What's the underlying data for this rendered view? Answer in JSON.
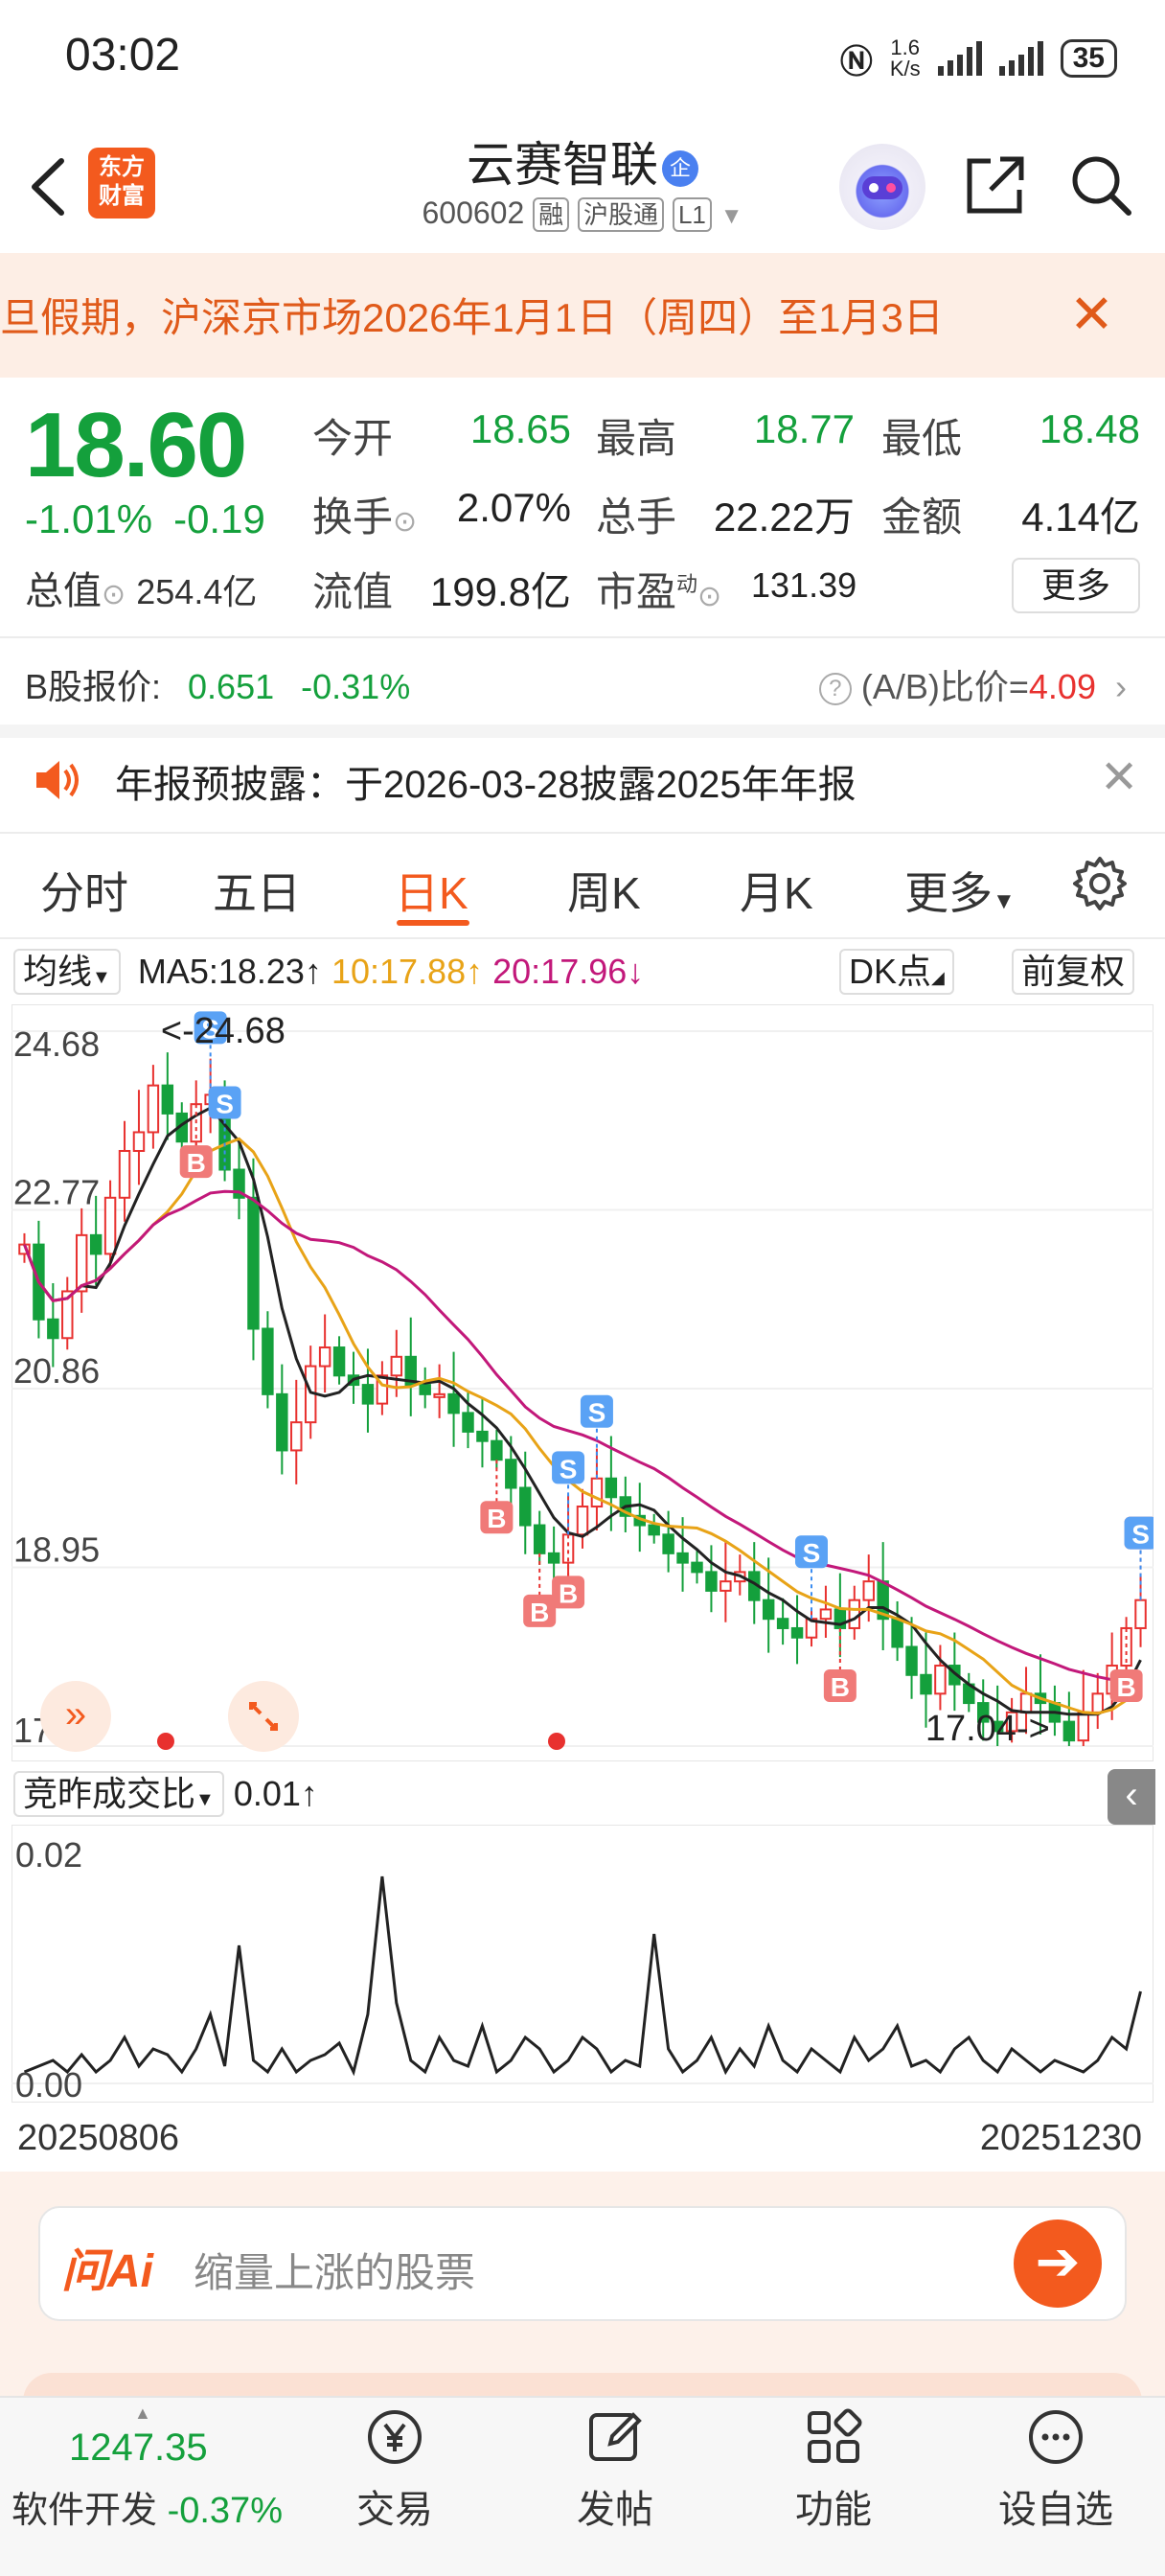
{
  "status_bar": {
    "time": "03:02",
    "net_speed": "1.6",
    "net_unit": "K/s",
    "battery": "35"
  },
  "header": {
    "logo_line1": "东方",
    "logo_line2": "财富",
    "stock_name": "云赛智联",
    "stock_badge": "企",
    "stock_code": "600602",
    "tags": [
      "融",
      "沪股通",
      "L1"
    ]
  },
  "notice": {
    "text": "旦假期，沪深京市场2026年1月1日（周四）至1月3日"
  },
  "quote": {
    "price": "18.60",
    "change_pct": "-1.01%",
    "change": "-0.19",
    "open_label": "今开",
    "open": "18.65",
    "high_label": "最高",
    "high": "18.77",
    "low_label": "最低",
    "low": "18.48",
    "turnover_label": "换手",
    "turnover": "2.07%",
    "volume_label": "总手",
    "volume": "22.22万",
    "amount_label": "金额",
    "amount": "4.14亿",
    "mktcap_label": "总值",
    "mktcap": "254.4亿",
    "float_label": "流值",
    "float_cap": "199.8亿",
    "pe_label": "市盈",
    "pe_sup": "动",
    "pe": "131.39",
    "more_label": "更多"
  },
  "bshare": {
    "label": "B股报价:",
    "price": "0.651",
    "change": "-0.31%",
    "ratio_label": "(A/B)比价=",
    "ratio": "4.09"
  },
  "annual": {
    "text": "年报预披露：于2026-03-28披露2025年年报"
  },
  "tabs": [
    "分时",
    "五日",
    "日K",
    "周K",
    "月K",
    "更多"
  ],
  "chart_header": {
    "ma_select": "均线",
    "ma5": "MA5:18.23↑",
    "ma10": "10:17.88↑",
    "ma20": "20:17.96↓",
    "dk_label": "DK点",
    "adjust_label": "前复权"
  },
  "colors": {
    "up": "#e8312f",
    "down": "#14a03c",
    "ma5": "#222222",
    "ma10": "#e8a317",
    "ma20": "#c2187a",
    "accent": "#f35a1e"
  },
  "chart_data": [
    {
      "type": "candlestick",
      "y_ticks": [
        "24.68",
        "22.77",
        "20.86",
        "18.95",
        "17.04"
      ],
      "ylim": [
        17.04,
        24.68
      ],
      "max_label": "<-24.68",
      "min_label": "17.04->",
      "closes": [
        22.4,
        21.6,
        21.4,
        21.9,
        22.5,
        22.3,
        22.9,
        23.4,
        23.6,
        24.1,
        23.8,
        23.5,
        23.9,
        24.0,
        23.2,
        22.9,
        21.5,
        20.8,
        20.2,
        20.5,
        21.1,
        21.3,
        21.0,
        20.9,
        20.7,
        21.0,
        21.2,
        20.9,
        20.8,
        20.8,
        20.6,
        20.4,
        20.3,
        20.1,
        19.8,
        19.4,
        19.1,
        19.0,
        19.3,
        19.6,
        19.9,
        19.7,
        19.5,
        19.4,
        19.3,
        19.1,
        19.0,
        18.9,
        18.7,
        18.8,
        18.9,
        18.6,
        18.4,
        18.3,
        18.2,
        18.4,
        18.5,
        18.3,
        18.6,
        18.8,
        18.4,
        18.1,
        17.8,
        17.6,
        17.9,
        17.7,
        17.5,
        17.3,
        17.2,
        17.4,
        17.6,
        17.5,
        17.3,
        17.1,
        17.4,
        17.6,
        17.9,
        18.3,
        18.6
      ],
      "buy_signals": 7,
      "sell_signals": 6
    },
    {
      "type": "line",
      "title": "竞昨成交比",
      "value": "0.01↑",
      "y_ticks": [
        "0.02",
        "0.00"
      ],
      "x_labels": [
        "20250806",
        "20251230"
      ],
      "values": [
        0.001,
        0.0015,
        0.002,
        0.001,
        0.0025,
        0.001,
        0.002,
        0.004,
        0.0015,
        0.003,
        0.0025,
        0.001,
        0.003,
        0.006,
        0.0015,
        0.012,
        0.002,
        0.001,
        0.003,
        0.001,
        0.002,
        0.0025,
        0.0035,
        0.001,
        0.006,
        0.018,
        0.007,
        0.002,
        0.001,
        0.004,
        0.002,
        0.0015,
        0.005,
        0.001,
        0.002,
        0.004,
        0.003,
        0.001,
        0.002,
        0.004,
        0.003,
        0.001,
        0.002,
        0.0015,
        0.013,
        0.003,
        0.001,
        0.002,
        0.004,
        0.001,
        0.003,
        0.0015,
        0.005,
        0.002,
        0.001,
        0.003,
        0.002,
        0.001,
        0.004,
        0.002,
        0.003,
        0.005,
        0.0015,
        0.002,
        0.001,
        0.003,
        0.004,
        0.002,
        0.001,
        0.003,
        0.002,
        0.001,
        0.002,
        0.0015,
        0.001,
        0.002,
        0.004,
        0.003,
        0.008
      ]
    }
  ],
  "ai": {
    "logo": "问Ai",
    "placeholder": "缩量上涨的股票"
  },
  "bottom_nav": {
    "index_value": "1247.35",
    "index_name": "软件开发",
    "index_change": "-0.37%",
    "items": [
      "交易",
      "发帖",
      "功能",
      "设自选"
    ]
  }
}
